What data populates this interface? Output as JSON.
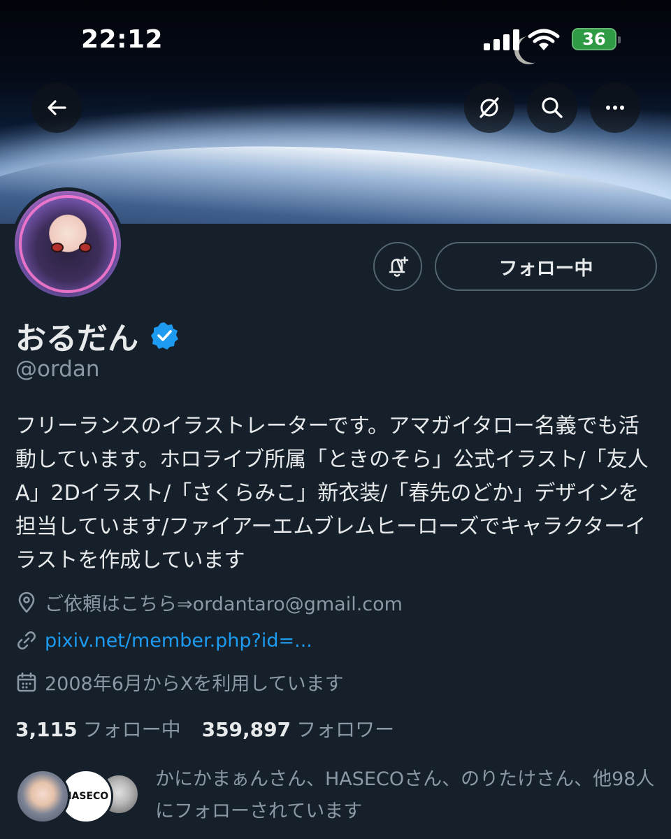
{
  "status_bar": {
    "time": "22:12",
    "battery": "36"
  },
  "header": {
    "back_icon": "arrow-left-icon",
    "grok_icon": "grok-icon",
    "search_icon": "search-icon",
    "more_icon": "more-dots-icon"
  },
  "profile": {
    "display_name": "おるだん",
    "verified": true,
    "handle": "@ordan",
    "follow_button_label": "フォロー中",
    "bio": "フリーランスのイラストレーターです。アマガイタロー名義でも活動しています。ホロライブ所属「ときのそら」公式イラスト/「友人A」2Dイラスト/「さくらみこ」新衣装/「春先のどか」デザインを担当しています/ファイアーエムブレムヒーローズでキャラクターイラストを作成しています",
    "location": "ご依頼はこちら⇒ordantaro@gmail.com",
    "website": "pixiv.net/member.php?id=...",
    "joined": "2008年6月からXを利用しています",
    "following_count": "3,115",
    "following_label": "フォロー中",
    "followers_count": "359,897",
    "followers_label": "フォロワー",
    "followed_by": "かにかまぁんさん、HASECOさん、のりたけさん、他98人にフォローされています",
    "followed_by_avatar_b_text": "HASECO"
  },
  "colors": {
    "background": "#15202b",
    "accent": "#1d9bf0",
    "secondary_text": "#8b98a5"
  }
}
